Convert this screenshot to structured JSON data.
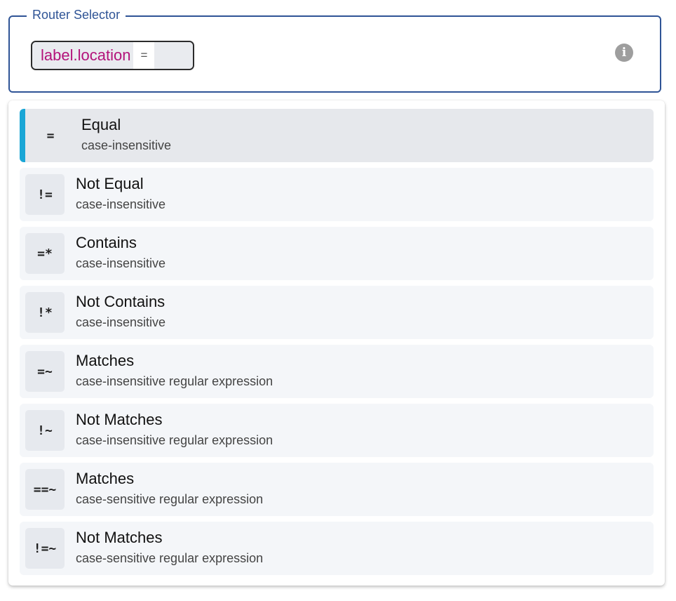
{
  "field": {
    "legend": "Router Selector",
    "chip_key": "label.location",
    "chip_operator": "=",
    "info_icon": "info-circle-icon"
  },
  "colors": {
    "border": "#2f5496",
    "key": "#b3127a",
    "accent": "#1aa6d6"
  },
  "options": [
    {
      "symbol": "=",
      "title": "Equal",
      "subtitle": "case-insensitive",
      "selected": true
    },
    {
      "symbol": "!=",
      "title": "Not Equal",
      "subtitle": "case-insensitive"
    },
    {
      "symbol": "=*",
      "title": "Contains",
      "subtitle": "case-insensitive"
    },
    {
      "symbol": "!*",
      "title": "Not Contains",
      "subtitle": "case-insensitive"
    },
    {
      "symbol": "=~",
      "title": "Matches",
      "subtitle": "case-insensitive regular expression"
    },
    {
      "symbol": "!~",
      "title": "Not Matches",
      "subtitle": "case-insensitive regular expression"
    },
    {
      "symbol": "==~",
      "title": "Matches",
      "subtitle": "case-sensitive regular expression"
    },
    {
      "symbol": "!=~",
      "title": "Not Matches",
      "subtitle": "case-sensitive regular expression"
    }
  ]
}
